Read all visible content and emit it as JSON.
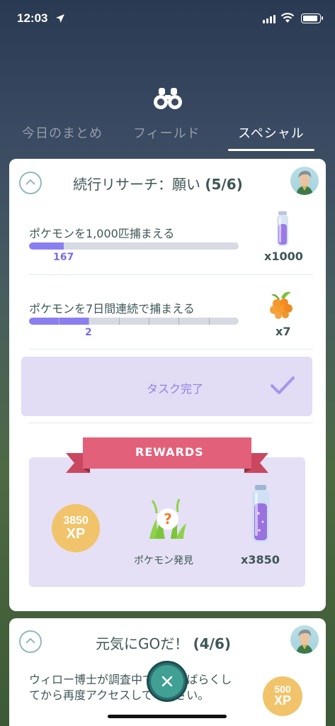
{
  "status_bar": {
    "time": "12:03"
  },
  "tabs": [
    {
      "label": "今日のまとめ",
      "active": false
    },
    {
      "label": "フィールド",
      "active": false
    },
    {
      "label": "スペシャル",
      "active": true
    }
  ],
  "research_card": {
    "title": "続行リサーチ：願い",
    "count": "(5/6)",
    "tasks": [
      {
        "text": "ポケモンを1,000匹捕まえる",
        "progress_value": "167",
        "progress_fraction": 0.167,
        "reward_amount": "x1000",
        "reward_icon": "lure-potion-icon"
      },
      {
        "text": "ポケモンを7日間連続で捕まえる",
        "progress_value": "2",
        "progress_fraction": 0.286,
        "segments": 7,
        "reward_amount": "x7",
        "reward_icon": "golden-berry-icon"
      }
    ],
    "task_complete_label": "タスク完了",
    "rewards_banner": "REWARDS",
    "rewards": [
      {
        "type": "xp",
        "amount": "3850",
        "unit": "XP"
      },
      {
        "type": "encounter",
        "label": "ポケモン発見",
        "icon": "mystery-encounter-icon"
      },
      {
        "type": "item",
        "amount": "x3850",
        "icon": "stardust-potion-icon"
      }
    ]
  },
  "second_card": {
    "title": "元気にGOだ！",
    "count": "(4/6)",
    "body": "ウィロー博士が調査中です。しばらくしてから再度アクセスしてください。",
    "xp_amount": "500",
    "xp_unit": "XP"
  },
  "colors": {
    "progress_fill": "#8a7ff0",
    "task_done_bg": "#e3dcf5",
    "rewards_bg": "#e5e0f6",
    "banner": "#e2607a",
    "xp_badge": "#f1c46b",
    "close_button": "#3fa093"
  }
}
